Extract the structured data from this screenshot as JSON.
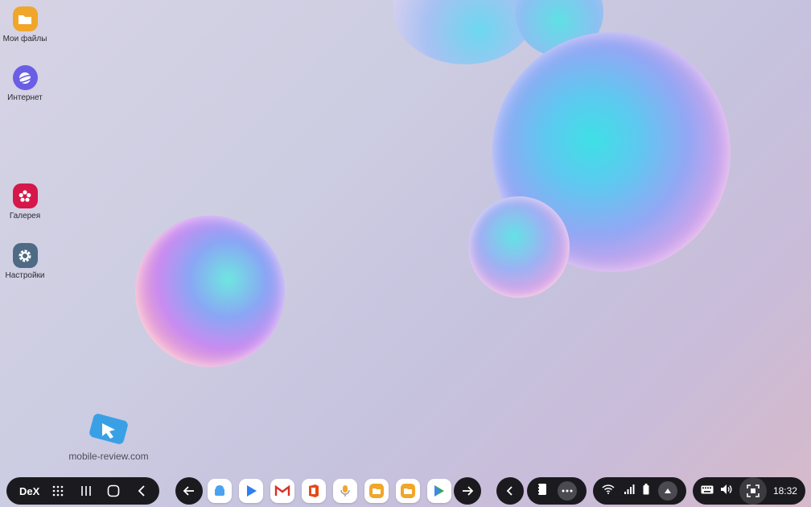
{
  "desktop": {
    "icons": [
      {
        "label": "Мои файлы",
        "color": "#f0a62a",
        "icon": "folder-icon"
      },
      {
        "label": "Интернет",
        "color": "#6a5ee6",
        "icon": "internet-planet-icon"
      },
      {
        "label": "Галерея",
        "color": "#d5174a",
        "icon": "gallery-flower-icon"
      },
      {
        "label": "Настройки",
        "color": "#4f6a84",
        "icon": "gear-icon"
      }
    ]
  },
  "watermark": {
    "text": "mobile-review.com"
  },
  "taskbar": {
    "dex_label": "DeX",
    "apps": [
      {
        "name": "android-app",
        "color": "#4aa3f0"
      },
      {
        "name": "play-movies",
        "color": "#2f7ff0"
      },
      {
        "name": "gmail",
        "color": "#d93025"
      },
      {
        "name": "office",
        "color": "#e64a19"
      },
      {
        "name": "voice-recorder",
        "color": "#f2a62a"
      },
      {
        "name": "files-1",
        "color": "#f0a62a"
      },
      {
        "name": "files-2",
        "color": "#f0a62a"
      },
      {
        "name": "play-store",
        "color": "#34a853"
      }
    ],
    "clock": "18:32"
  }
}
